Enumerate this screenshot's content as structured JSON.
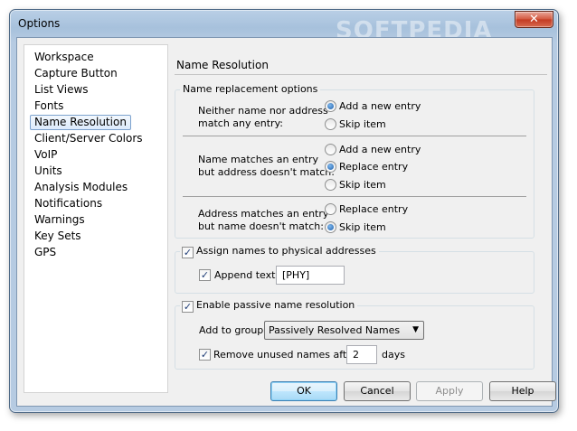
{
  "window": {
    "title": "Options",
    "close_glyph": "✕"
  },
  "watermark": "SOFTPEDIA",
  "sidebar": {
    "items": [
      {
        "label": "Workspace"
      },
      {
        "label": "Capture Button"
      },
      {
        "label": "List Views"
      },
      {
        "label": "Fonts"
      },
      {
        "label": "Name Resolution",
        "selected": true
      },
      {
        "label": "Client/Server Colors"
      },
      {
        "label": "VoIP"
      },
      {
        "label": "Units"
      },
      {
        "label": "Analysis Modules"
      },
      {
        "label": "Notifications"
      },
      {
        "label": "Warnings"
      },
      {
        "label": "Key Sets"
      },
      {
        "label": "GPS"
      }
    ]
  },
  "page": {
    "title": "Name Resolution",
    "replacement": {
      "caption": "Name replacement options",
      "rules": [
        {
          "label_line1": "Neither name nor address",
          "label_line2": "match any entry:",
          "options": [
            "Add a new entry",
            "Skip item"
          ],
          "selected": 0
        },
        {
          "label_line1": "Name matches an entry",
          "label_line2": "but address doesn't match:",
          "options": [
            "Add a new entry",
            "Replace entry",
            "Skip item"
          ],
          "selected": 1
        },
        {
          "label_line1": "Address matches an entry",
          "label_line2": "but name doesn't match:",
          "options": [
            "Replace entry",
            "Skip item"
          ],
          "selected": 1
        }
      ]
    },
    "assign": {
      "caption": "Assign names to physical addresses",
      "checked": true,
      "append_label": "Append text:",
      "append_checked": true,
      "append_value": "[PHY]"
    },
    "passive": {
      "caption": "Enable passive name resolution",
      "checked": true,
      "group_label": "Add to group:",
      "group_value": "Passively Resolved Names",
      "remove_label": "Remove unused names after",
      "remove_checked": true,
      "remove_value": "2",
      "remove_unit": "days"
    }
  },
  "buttons": {
    "ok": "OK",
    "cancel": "Cancel",
    "apply": "Apply",
    "help": "Help"
  },
  "colors": {
    "accent": "#3c7fb1",
    "selection": "#dcebfc"
  },
  "icons": {
    "check": "✓",
    "dropdown": "▼"
  }
}
